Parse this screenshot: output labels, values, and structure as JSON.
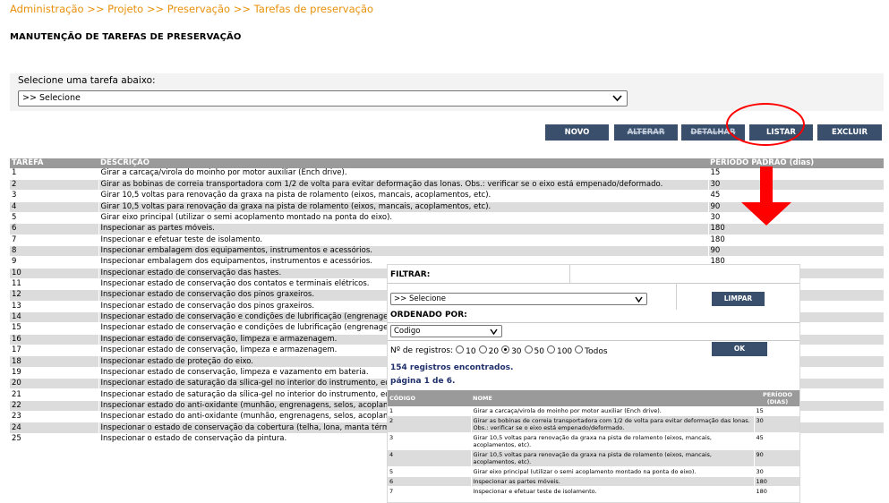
{
  "breadcrumb": "Administração >> Projeto >> Preservação >> Tarefas de preservação",
  "page_title": "MANUTENÇÃO DE TAREFAS DE PRESERVAÇÃO",
  "selector": {
    "label": "Selecione uma tarefa abaixo:",
    "value": ">> Selecione"
  },
  "buttons": {
    "novo": "NOVO",
    "alterar": "ALTERAR",
    "detalhar": "DETALHAR",
    "listar": "LISTAR",
    "excluir": "EXCLUIR"
  },
  "colors": {
    "breadcrumb": "#e8910a",
    "button": "#394f6c",
    "header": "#9a9a9a",
    "row_alt": "#dcdcdc",
    "annotation": "#ff0000"
  },
  "main_table": {
    "headers": [
      "TAREFA",
      "DESCRIÇÃO",
      "PERÍODO PADRÃO (dias)"
    ],
    "rows": [
      [
        "1",
        "Girar a carcaça/virola do moinho por motor auxiliar (Ench drive).",
        "15"
      ],
      [
        "2",
        "Girar as bobinas de correia transportadora com 1/2 de volta para evitar deformação das lonas. Obs.: verificar se o eixo está empenado/deformado.",
        "30"
      ],
      [
        "3",
        "Girar 10,5 voltas para renovação da graxa na pista de rolamento (eixos, mancais, acoplamentos, etc).",
        "45"
      ],
      [
        "4",
        "Girar 10,5 voltas para renovação da graxa na pista de rolamento (eixos, mancais, acoplamentos, etc).",
        "90"
      ],
      [
        "5",
        "Girar eixo principal (utilizar o semi acoplamento montado na ponta do eixo).",
        "30"
      ],
      [
        "6",
        "Inspecionar as partes móveis.",
        "180"
      ],
      [
        "7",
        "Inspecionar e efetuar teste de isolamento.",
        "180"
      ],
      [
        "8",
        "Inspecionar embalagem dos equipamentos, instrumentos e acessórios.",
        "90"
      ],
      [
        "9",
        "Inspecionar embalagem dos equipamentos, instrumentos e acessórios.",
        "180"
      ],
      [
        "10",
        "Inspecionar estado de conservação das hastes.",
        ""
      ],
      [
        "11",
        "Inspecionar estado de conservação dos contatos e terminais elétricos.",
        ""
      ],
      [
        "12",
        "Inspecionar estado de conservação dos pinos graxeiros.",
        ""
      ],
      [
        "13",
        "Inspecionar estado de conservação dos pinos graxeiros.",
        ""
      ],
      [
        "14",
        "Inspecionar estado de conservação e condições de lubrificação (engrenagem, se",
        ""
      ],
      [
        "15",
        "Inspecionar estado de conservação e condições de lubrificação (engrenagem, se",
        ""
      ],
      [
        "16",
        "Inspecionar estado de conservação, limpeza e armazenagem.",
        ""
      ],
      [
        "17",
        "Inspecionar estado de conservação, limpeza e armazenagem.",
        ""
      ],
      [
        "18",
        "Inspecionar estado de proteção do eixo.",
        ""
      ],
      [
        "19",
        "Inspecionar estado de conservação, limpeza e vazamento em bateria.",
        ""
      ],
      [
        "20",
        "Inspecionar estado de saturação da sílica-gel no interior do instrumento, equipa",
        ""
      ],
      [
        "21",
        "Inspecionar estado de saturação da sílica-gel no interior do instrumento, equipa",
        ""
      ],
      [
        "22",
        "Inspecionar estado do anti-oxidante (munhão, engrenagens, selos, acoplamento",
        ""
      ],
      [
        "23",
        "Inspecionar estado do anti-oxidante (munhão, engrenagens, selos, acoplamento",
        ""
      ],
      [
        "24",
        "Inspecionar o estado de conservação da cobertura (telha, lona, manta térmica,",
        ""
      ],
      [
        "25",
        "Inspecionar o estado de conservação da pintura.",
        ""
      ]
    ]
  },
  "popup": {
    "filter_label": "FILTRAR:",
    "filter_value": ">> Selecione",
    "clear_button": "LIMPAR",
    "order_label": "ORDENADO POR:",
    "order_value": "Codigo",
    "records_label": "Nº de registros:",
    "records_options": [
      "10",
      "20",
      "30",
      "50",
      "100",
      "Todos"
    ],
    "records_selected": "30",
    "ok_button": "OK",
    "found_text": "154 registros encontrados.",
    "page_text": "página 1 de 6.",
    "result_headers": [
      "CÓDIGO",
      "NOME",
      "PERÍODO (DIAS)"
    ],
    "result_rows": [
      [
        "1",
        "Girar a carcaça/virola do moinho por motor auxiliar (Ench drive).",
        "15"
      ],
      [
        "2",
        "Girar as bobinas de correia transportadora com 1/2 de volta para evitar deformação das lonas. Obs.: verificar se o eixo está empenado/deformado.",
        "30"
      ],
      [
        "3",
        "Girar 10,5 voltas para renovação da graxa na pista de rolamento (eixos, mancais, acoplamentos, etc).",
        "45"
      ],
      [
        "4",
        "Girar 10,5 voltas para renovação da graxa na pista de rolamento (eixos, mancais, acoplamentos, etc).",
        "90"
      ],
      [
        "5",
        "Girar eixo principal (utilizar o semi acoplamento montado na ponta do eixo).",
        "30"
      ],
      [
        "6",
        "Inspecionar as partes móveis.",
        "180"
      ],
      [
        "7",
        "Inspecionar e efetuar teste de isolamento.",
        "180"
      ]
    ]
  }
}
